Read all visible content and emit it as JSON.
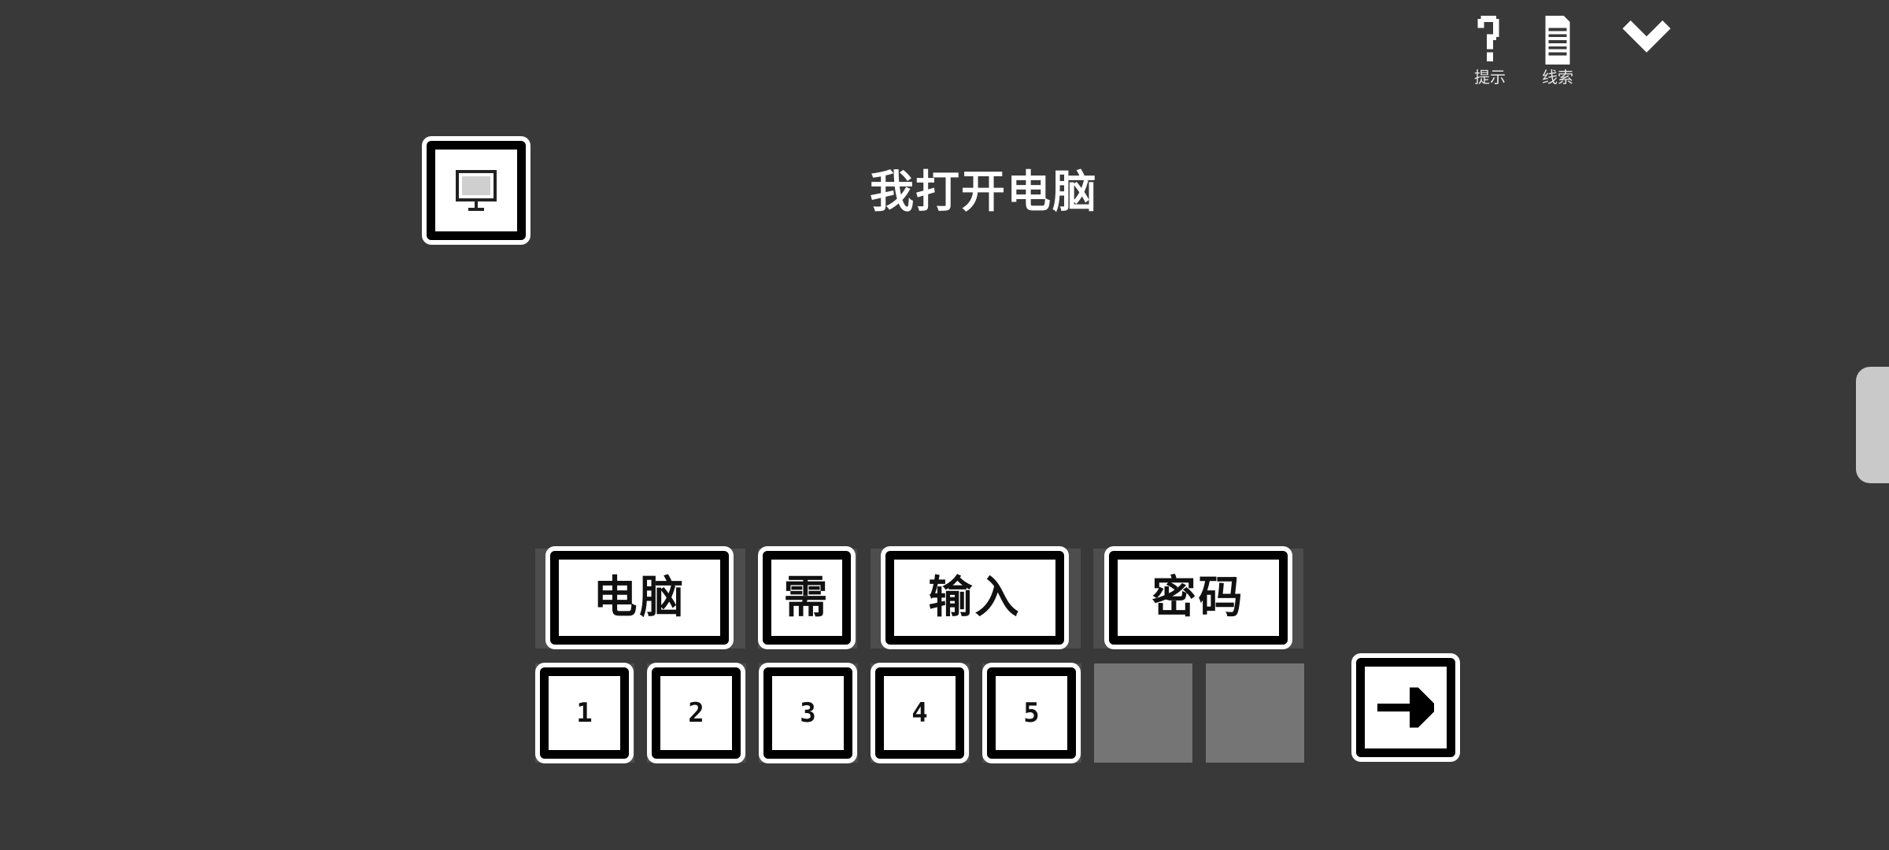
{
  "toolbar": {
    "hint_label": "提示",
    "clue_label": "线索",
    "hint_icon": "question-mark-icon",
    "clue_icon": "document-icon",
    "collapse_icon": "chevron-down-icon"
  },
  "scene": {
    "icon": "computer-monitor-icon",
    "title": "我打开电脑"
  },
  "word_tiles": [
    {
      "text": "电脑"
    },
    {
      "text": "需"
    },
    {
      "text": "输入"
    },
    {
      "text": "密码"
    }
  ],
  "number_tiles": [
    {
      "text": "1"
    },
    {
      "text": "2"
    },
    {
      "text": "3"
    },
    {
      "text": "4"
    },
    {
      "text": "5"
    }
  ],
  "empty_slots": 2,
  "next_icon": "arrow-right-icon",
  "colors": {
    "background": "#393939",
    "tile_fill": "#ffffff",
    "tile_border": "#000000",
    "empty_slot": "#757575",
    "side_tab": "#c9c9c9"
  }
}
